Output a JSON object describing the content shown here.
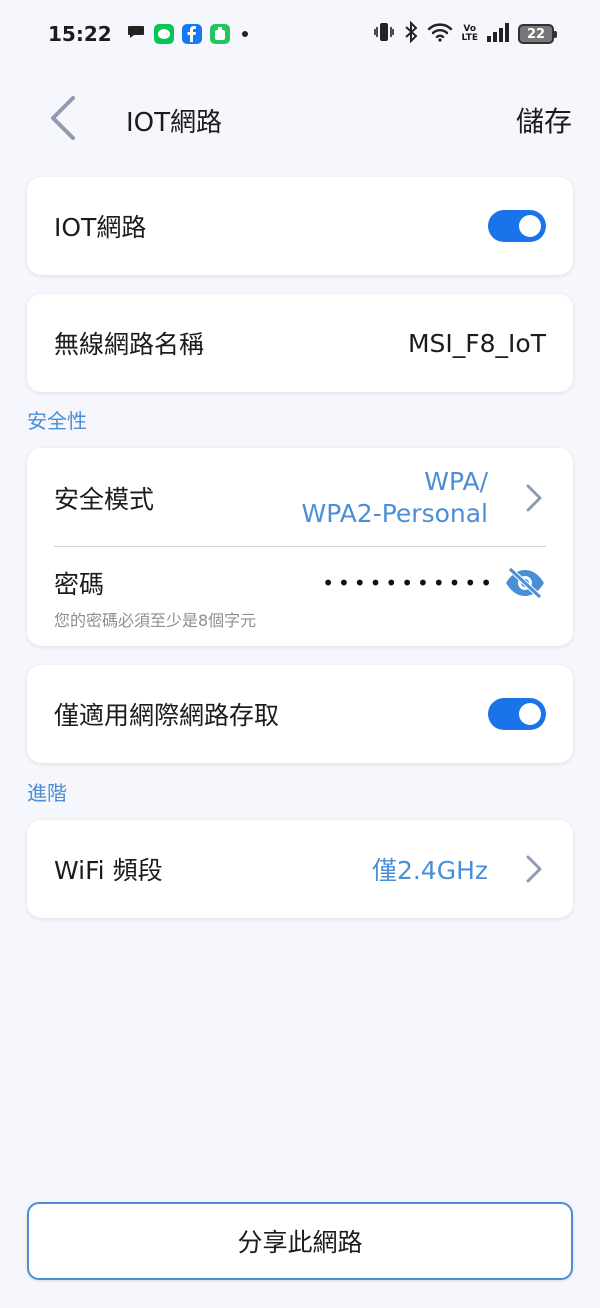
{
  "status_bar": {
    "time": "15:22",
    "battery": "22",
    "volte_top": "Vo",
    "volte_bottom": "LTE",
    "icons": [
      "chat-bubble-icon",
      "line-app-icon",
      "facebook-app-icon",
      "green-app-icon",
      "vibrate-icon",
      "bluetooth-icon",
      "wifi-icon",
      "signal-icon",
      "battery-icon"
    ]
  },
  "header": {
    "title": "IOT網路",
    "save_label": "儲存"
  },
  "iot_card": {
    "label": "IOT網路",
    "enabled": true
  },
  "ssid_card": {
    "label": "無線網路名稱",
    "value": "MSI_F8_IoT"
  },
  "security_section": {
    "title": "安全性"
  },
  "security_card": {
    "mode_label": "安全模式",
    "mode_value_line1": "WPA/",
    "mode_value_line2": "WPA2-Personal",
    "password_label": "密碼",
    "password_mask": "•••••••••••",
    "password_hint": "您的密碼必須至少是8個字元"
  },
  "internet_card": {
    "label": "僅適用網際網路存取",
    "enabled": true
  },
  "advanced_section": {
    "title": "進階"
  },
  "band_card": {
    "label": "WiFi 頻段",
    "value": "僅2.4GHz"
  },
  "share_button": {
    "label": "分享此網路"
  },
  "colors": {
    "accent": "#1a73e8",
    "link": "#4a8fd6",
    "background": "#f5f7fc"
  }
}
